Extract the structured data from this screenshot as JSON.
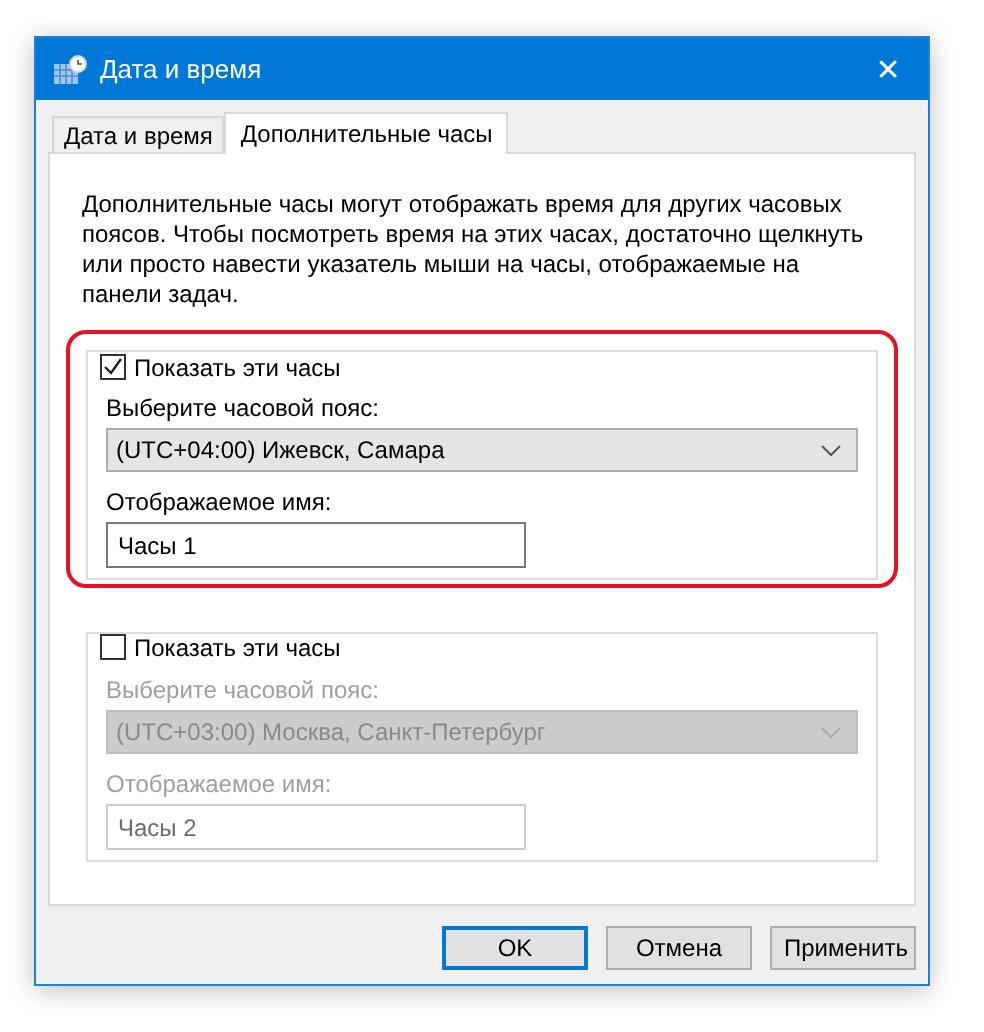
{
  "window": {
    "title": "Дата и время",
    "close": "✕"
  },
  "tabs": [
    {
      "label": "Дата и время",
      "selected": false
    },
    {
      "label": "Дополнительные часы",
      "selected": true
    }
  ],
  "description": "Дополнительные часы могут отображать время для других часовых поясов. Чтобы посмотреть время на этих часах, достаточно щелкнуть или просто навести указатель мыши на часы, отображаемые на панели задач.",
  "clocks": [
    {
      "checkbox_label": "Показать эти часы",
      "checked": true,
      "highlighted": true,
      "timezone_label": "Выберите часовой пояс:",
      "timezone": "(UTC+04:00) Ижевск, Самара",
      "name_label": "Отображаемое имя:",
      "name": "Часы 1"
    },
    {
      "checkbox_label": "Показать эти часы",
      "checked": false,
      "highlighted": false,
      "timezone_label": "Выберите часовой пояс:",
      "timezone": "(UTC+03:00) Москва, Санкт-Петербург",
      "name_label": "Отображаемое имя:",
      "name": "Часы 2"
    }
  ],
  "buttons": [
    {
      "label": "OK",
      "default": true
    },
    {
      "label": "Отмена",
      "default": false
    },
    {
      "label": "Применить",
      "default": false
    }
  ]
}
